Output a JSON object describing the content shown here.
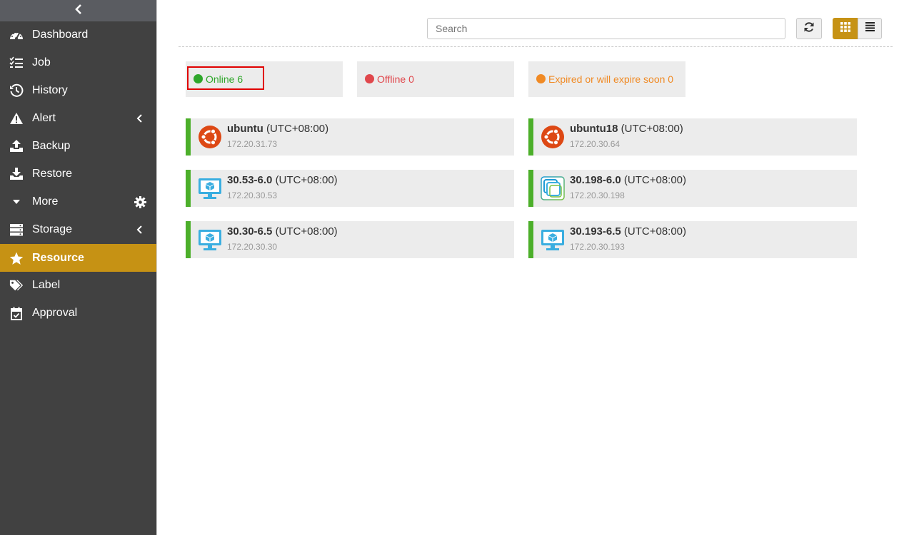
{
  "sidebar": {
    "items": [
      {
        "label": "Dashboard",
        "icon": "dashboard-icon"
      },
      {
        "label": "Job",
        "icon": "job-list-icon"
      },
      {
        "label": "History",
        "icon": "history-icon"
      },
      {
        "label": "Alert",
        "icon": "alert-icon"
      },
      {
        "label": "Backup",
        "icon": "backup-icon"
      },
      {
        "label": "Restore",
        "icon": "restore-icon"
      },
      {
        "label": "More",
        "icon": "caret-down-icon"
      },
      {
        "label": "Storage",
        "icon": "storage-icon"
      },
      {
        "label": "Resource",
        "icon": "star-icon"
      },
      {
        "label": "Label",
        "icon": "tags-icon"
      },
      {
        "label": "Approval",
        "icon": "calendar-check-icon"
      }
    ],
    "active": "Resource"
  },
  "toolbar": {
    "search_placeholder": "Search",
    "view_mode": "grid"
  },
  "status": {
    "online": {
      "label": "Online 6",
      "color": "#2fa72b"
    },
    "offline": {
      "label": "Offline 0",
      "color": "#e0474c"
    },
    "expired": {
      "label": "Expired or will expire soon 0",
      "color": "#f08a24"
    }
  },
  "resources": [
    {
      "name": "ubuntu",
      "tz": "(UTC+08:00)",
      "ip": "172.20.31.73",
      "icon": "ubuntu-icon"
    },
    {
      "name": "ubuntu18",
      "tz": "(UTC+08:00)",
      "ip": "172.20.30.64",
      "icon": "ubuntu-icon"
    },
    {
      "name": "30.53-6.0",
      "tz": "(UTC+08:00)",
      "ip": "172.20.30.53",
      "icon": "vm-monitor-icon"
    },
    {
      "name": "30.198-6.0",
      "tz": "(UTC+08:00)",
      "ip": "172.20.30.198",
      "icon": "vmware-icon"
    },
    {
      "name": "30.30-6.5",
      "tz": "(UTC+08:00)",
      "ip": "172.20.30.30",
      "icon": "vm-monitor-icon"
    },
    {
      "name": "30.193-6.5",
      "tz": "(UTC+08:00)",
      "ip": "172.20.30.193",
      "icon": "vm-monitor-icon"
    }
  ],
  "colors": {
    "accent": "#c69214",
    "sidebar_bg": "#414141",
    "online_bar": "#4caf2a"
  }
}
